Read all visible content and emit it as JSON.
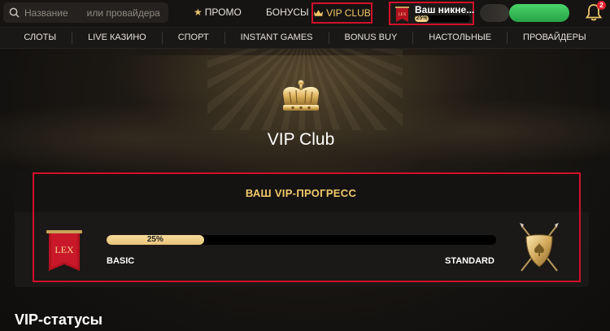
{
  "header": {
    "search": {
      "placeholder_part1": "Название",
      "placeholder_part2": "или провайдера",
      "icon": "search-icon"
    },
    "promo_label": "ПРОМО",
    "bonuses_label": "БОНУСЫ",
    "vip_club_label": "VIP CLUB",
    "profile": {
      "nickname": "Ваш никне...",
      "progress_text": "25%",
      "progress_fraction": 0.25
    },
    "notifications_count": "2",
    "colors": {
      "accent_red": "#d0102b",
      "gold": "#f2c96b",
      "green_button": "#37bd58"
    }
  },
  "subnav": {
    "items": [
      {
        "label": "СЛОТЫ"
      },
      {
        "label": "LIVE КАЗИНО"
      },
      {
        "label": "СПОРТ"
      },
      {
        "label": "INSTANT GAMES"
      },
      {
        "label": "BONUS BUY"
      },
      {
        "label": "НАСТОЛЬНЫЕ"
      },
      {
        "label": "ПРОВАЙДЕРЫ"
      }
    ]
  },
  "hero": {
    "title": "VIP Club",
    "icon": "crown-icon"
  },
  "vip_progress": {
    "title": "ВАШ VIP-ПРОГРЕСС",
    "progress_text": "25%",
    "progress_fraction": 0.25,
    "current_level": "BASIC",
    "next_level": "STANDARD",
    "current_badge_text": "LEX",
    "current_icon": "banner-icon",
    "next_icon": "shield-icon"
  },
  "statuses": {
    "title": "VIP-статусы"
  }
}
